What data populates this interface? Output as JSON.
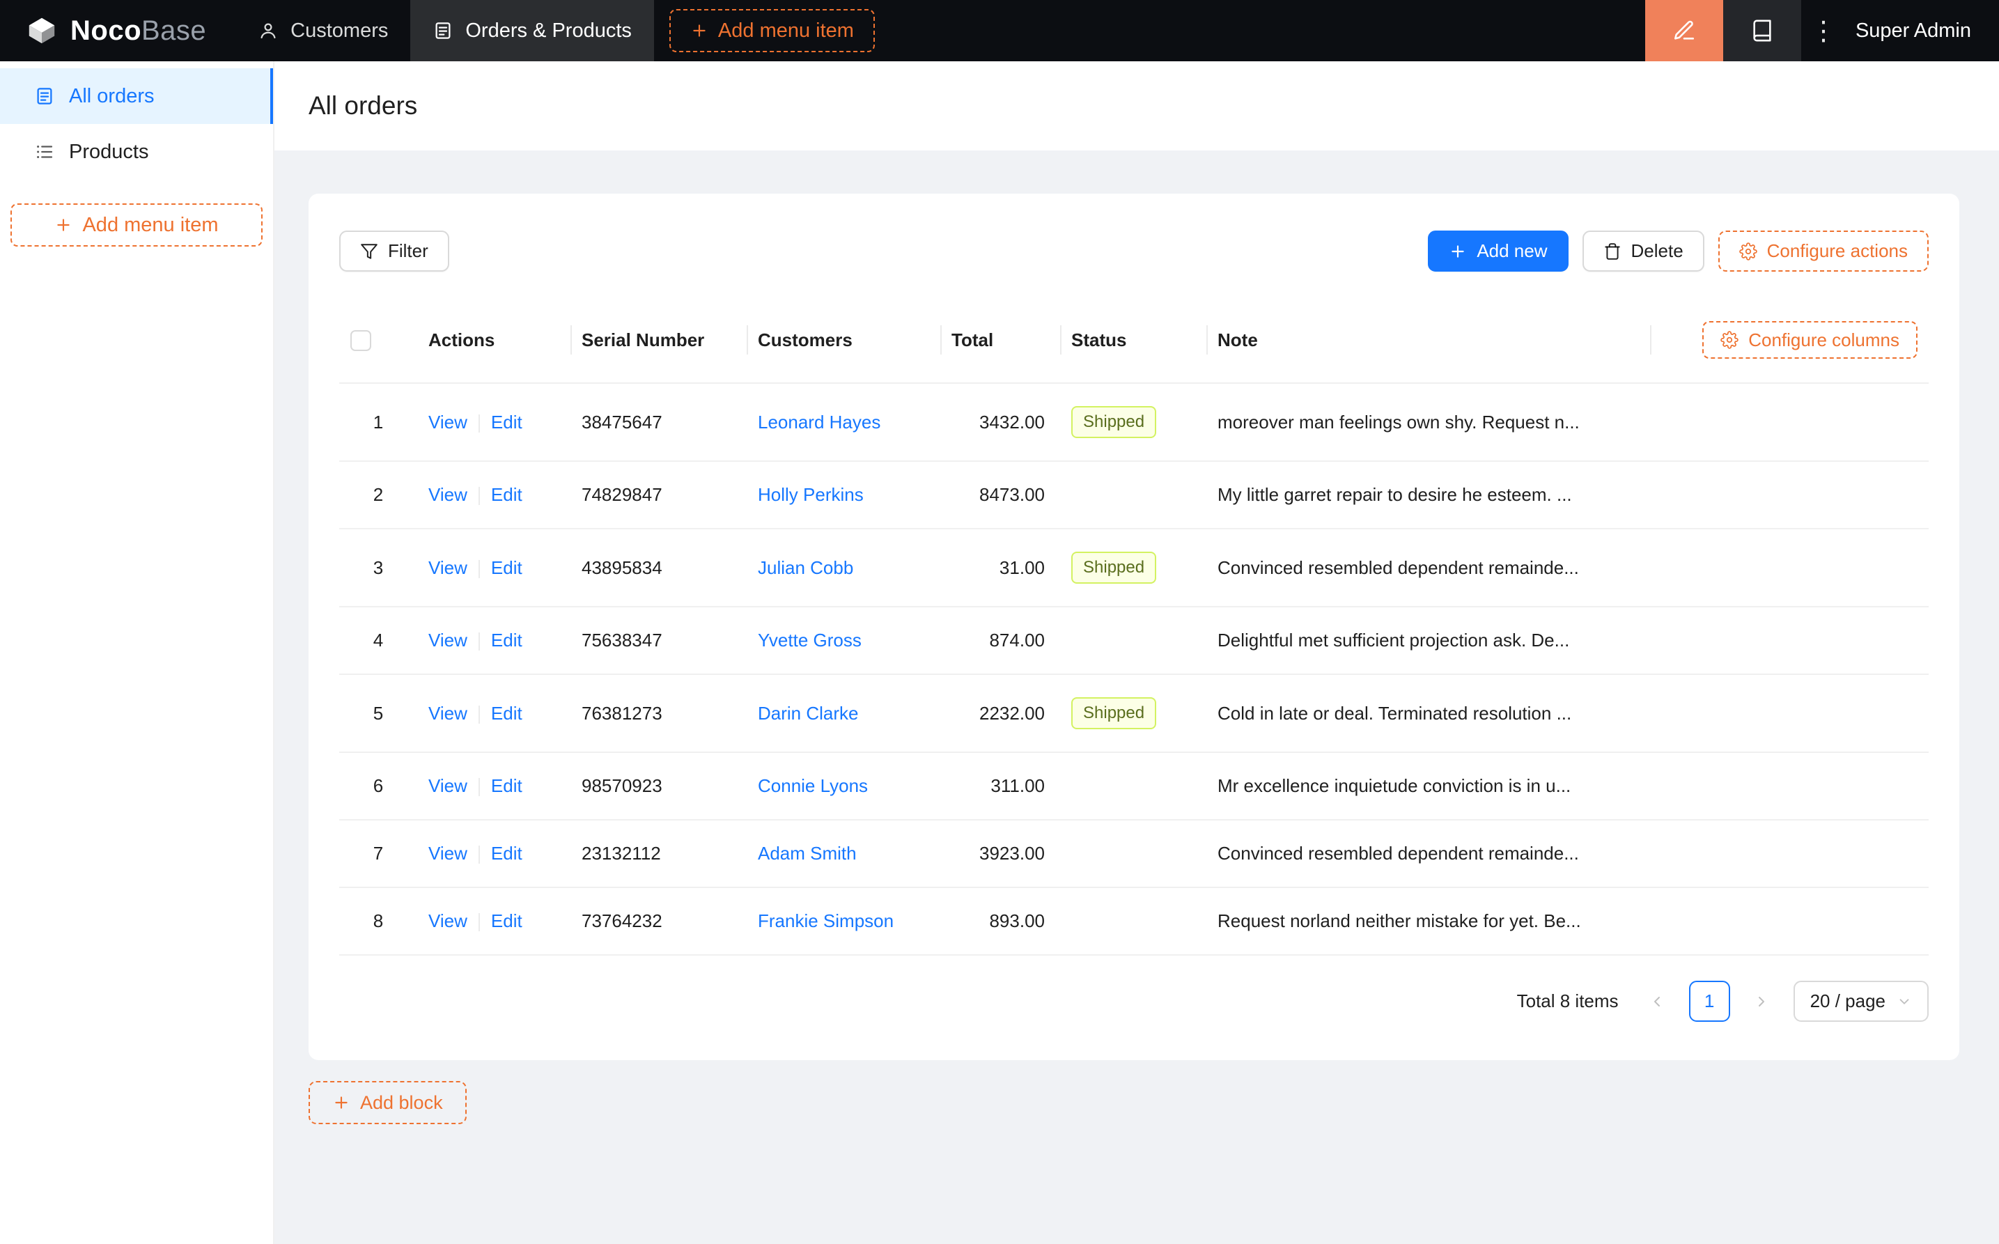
{
  "navbar": {
    "logo_bold": "Noco",
    "logo_light": "Base",
    "menu": [
      {
        "label": "Customers"
      },
      {
        "label": "Orders & Products"
      }
    ],
    "add_menu_item_label": "Add menu item",
    "more_glyph": "⋮",
    "user_label": "Super Admin"
  },
  "sidebar": {
    "items": [
      {
        "label": "All orders"
      },
      {
        "label": "Products"
      }
    ],
    "add_menu_item_label": "Add menu item"
  },
  "page": {
    "title": "All orders"
  },
  "toolbar": {
    "filter_label": "Filter",
    "add_new_label": "Add new",
    "delete_label": "Delete",
    "configure_actions_label": "Configure actions"
  },
  "table": {
    "configure_columns_label": "Configure columns",
    "headers": {
      "actions": "Actions",
      "serial": "Serial Number",
      "customers": "Customers",
      "total": "Total",
      "status": "Status",
      "note": "Note"
    },
    "action_labels": {
      "view": "View",
      "edit": "Edit"
    },
    "rows": [
      {
        "index": "1",
        "serial": "38475647",
        "customer": "Leonard Hayes",
        "total": "3432.00",
        "status": "Shipped",
        "note": "moreover man feelings own shy. Request n..."
      },
      {
        "index": "2",
        "serial": "74829847",
        "customer": "Holly Perkins",
        "total": "8473.00",
        "status": "",
        "note": "My little garret repair to desire he esteem. ..."
      },
      {
        "index": "3",
        "serial": "43895834",
        "customer": "Julian Cobb",
        "total": "31.00",
        "status": "Shipped",
        "note": "Convinced resembled dependent remainde..."
      },
      {
        "index": "4",
        "serial": "75638347",
        "customer": "Yvette Gross",
        "total": "874.00",
        "status": "",
        "note": "Delightful met sufficient projection ask. De..."
      },
      {
        "index": "5",
        "serial": "76381273",
        "customer": "Darin Clarke",
        "total": "2232.00",
        "status": "Shipped",
        "note": "Cold in late or deal. Terminated resolution ..."
      },
      {
        "index": "6",
        "serial": "98570923",
        "customer": "Connie Lyons",
        "total": "311.00",
        "status": "",
        "note": "Mr excellence inquietude conviction is in u..."
      },
      {
        "index": "7",
        "serial": "23132112",
        "customer": "Adam Smith",
        "total": "3923.00",
        "status": "",
        "note": "Convinced resembled dependent remainde..."
      },
      {
        "index": "8",
        "serial": "73764232",
        "customer": "Frankie Simpson",
        "total": "893.00",
        "status": "",
        "note": "Request norland neither mistake for yet. Be..."
      }
    ]
  },
  "pagination": {
    "total_label": "Total 8 items",
    "current_page": "1",
    "page_size_label": "20 / page"
  },
  "footer": {
    "add_block_label": "Add block"
  },
  "colors": {
    "navbar_bg": "#0c0e12",
    "primary_blue": "#1677ff",
    "accent_orange": "#ee7230",
    "designer_button_bg": "#f0815a",
    "sidebar_active_bg": "#e6f4ff",
    "status_tag_bg": "#fcffe6",
    "status_tag_border": "#d3f261",
    "content_bg": "#f0f2f5"
  }
}
